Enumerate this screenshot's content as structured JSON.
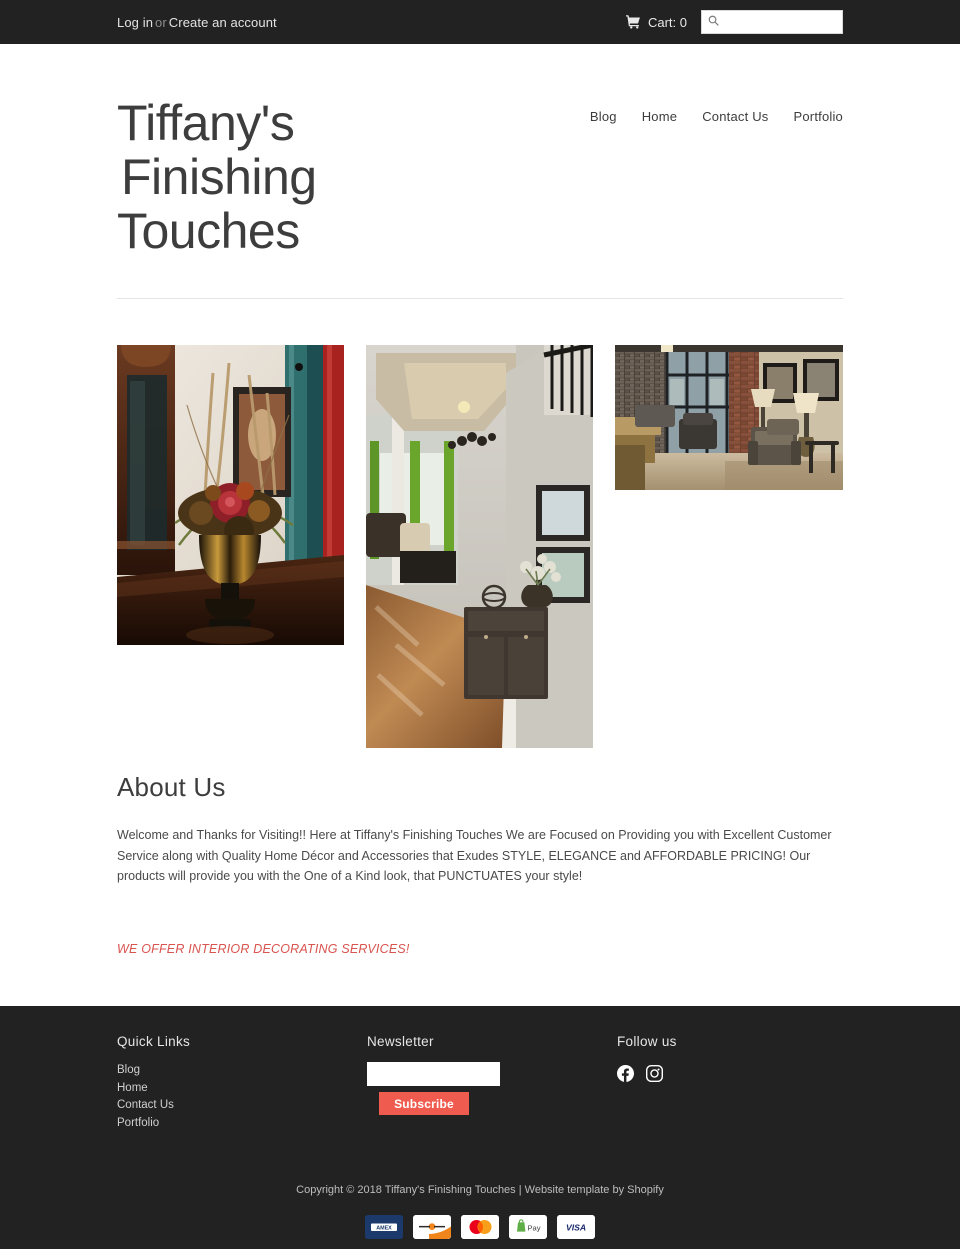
{
  "topbar": {
    "login_label": "Log in",
    "or_label": "or",
    "create_account_label": "Create an account",
    "cart_label": "Cart: 0",
    "cart_icon": "shopping-cart-icon",
    "search_icon": "search-icon",
    "search_value": "",
    "search_placeholder": ""
  },
  "header": {
    "logo_line1": "Tiffany's",
    "logo_line2": "Finishing",
    "logo_line3": "Touches",
    "nav": [
      {
        "label": "Blog"
      },
      {
        "label": "Home"
      },
      {
        "label": "Contact Us"
      },
      {
        "label": "Portfolio"
      }
    ]
  },
  "gallery": {
    "images": [
      {
        "alt": "Floral arrangement in ornate gold and black urn on dark wood table"
      },
      {
        "alt": "Home foyer with dark sideboard, framed mirrors and green drapes"
      },
      {
        "alt": "Lounge seating area with brick wall, patterned armchairs and lamps"
      }
    ]
  },
  "about": {
    "heading": "About Us",
    "body": "Welcome and Thanks for Visiting!! Here at Tiffany's Finishing Touches We are Focused on Providing you with Excellent Customer Service along with Quality Home Décor and Accessories that Exudes STYLE, ELEGANCE and AFFORDABLE PRICING! Our products will provide you with the One of a Kind look, that PUNCTUATES your style!",
    "services_note": "WE OFFER INTERIOR DECORATING SERVICES!",
    "services_color": "#d9534f"
  },
  "footer": {
    "quick_links_heading": "Quick Links",
    "quick_links": [
      {
        "label": "Blog"
      },
      {
        "label": "Home"
      },
      {
        "label": "Contact Us"
      },
      {
        "label": "Portfolio"
      }
    ],
    "newsletter_heading": "Newsletter",
    "newsletter_value": "",
    "newsletter_placeholder": "",
    "subscribe_label": "Subscribe",
    "subscribe_color": "#f05b4f",
    "follow_heading": "Follow us",
    "social": [
      {
        "name": "facebook-icon"
      },
      {
        "name": "instagram-icon"
      }
    ],
    "copyright": "Copyright © 2018 Tiffany's Finishing Touches | Website template by Shopify",
    "payments": [
      {
        "name": "amex",
        "label": "AMEX"
      },
      {
        "name": "discover",
        "label": "DISCOVER"
      },
      {
        "name": "mastercard",
        "label": "Mastercard"
      },
      {
        "name": "shop-pay",
        "label": "Pay"
      },
      {
        "name": "visa",
        "label": "VISA"
      }
    ]
  }
}
